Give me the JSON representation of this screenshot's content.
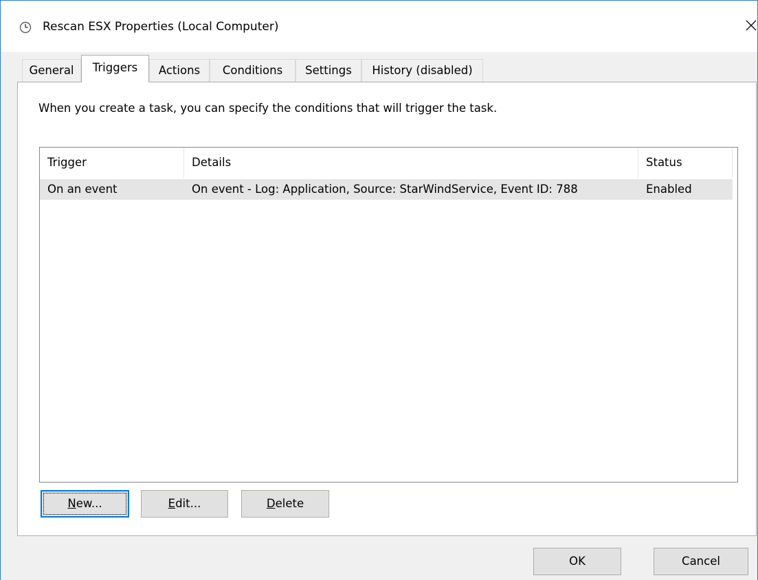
{
  "window": {
    "title": "Rescan ESX  Properties (Local Computer)",
    "icon": "clock-icon",
    "close_glyph": "✕"
  },
  "tabs": [
    {
      "label": "General",
      "active": false
    },
    {
      "label": "Triggers",
      "active": true
    },
    {
      "label": "Actions",
      "active": false
    },
    {
      "label": "Conditions",
      "active": false
    },
    {
      "label": "Settings",
      "active": false
    },
    {
      "label": "History (disabled)",
      "active": false
    }
  ],
  "triggers_tab": {
    "intro": "When you create a task, you can specify the conditions that will trigger the task.",
    "columns": [
      "Trigger",
      "Details",
      "Status"
    ],
    "rows": [
      {
        "trigger": "On an event",
        "details": "On event - Log: Application, Source: StarWindService, Event ID: 788",
        "status": "Enabled",
        "selected": true
      }
    ],
    "buttons": {
      "new": {
        "mnemonic": "N",
        "rest": "ew..."
      },
      "edit": {
        "mnemonic": "E",
        "rest": "dit..."
      },
      "delete": {
        "mnemonic": "D",
        "rest": "elete"
      }
    }
  },
  "footer": {
    "ok_label": "OK",
    "cancel_label": "Cancel"
  },
  "colors": {
    "window_border": "#2b79d6",
    "selection": "#e5e5e5",
    "default_button_border": "#0078d7"
  }
}
